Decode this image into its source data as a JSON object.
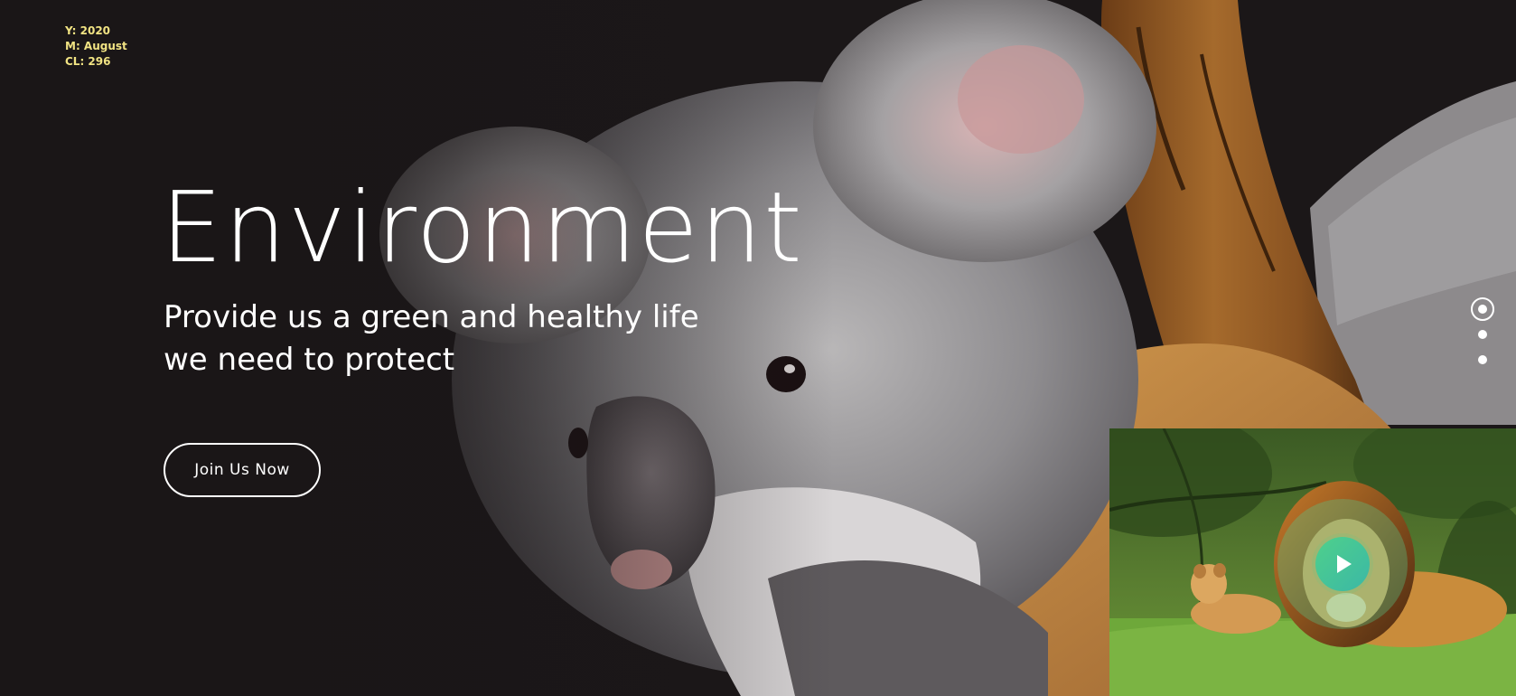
{
  "debug": {
    "year": "Y: 2020",
    "month": "M: August",
    "cl": "CL: 296"
  },
  "hero": {
    "title": "Environment",
    "subtitle_line1": "Provide us a green and healthy life",
    "subtitle_line2": "we need to protect",
    "cta_label": "Join Us Now"
  },
  "slider": {
    "slides": 3,
    "active_index": 0
  },
  "video": {
    "play_icon": "play-icon"
  },
  "colors": {
    "background": "#1a1617",
    "debug_text": "#f1e383",
    "play_button": "#4fd08b",
    "text": "#ffffff"
  }
}
